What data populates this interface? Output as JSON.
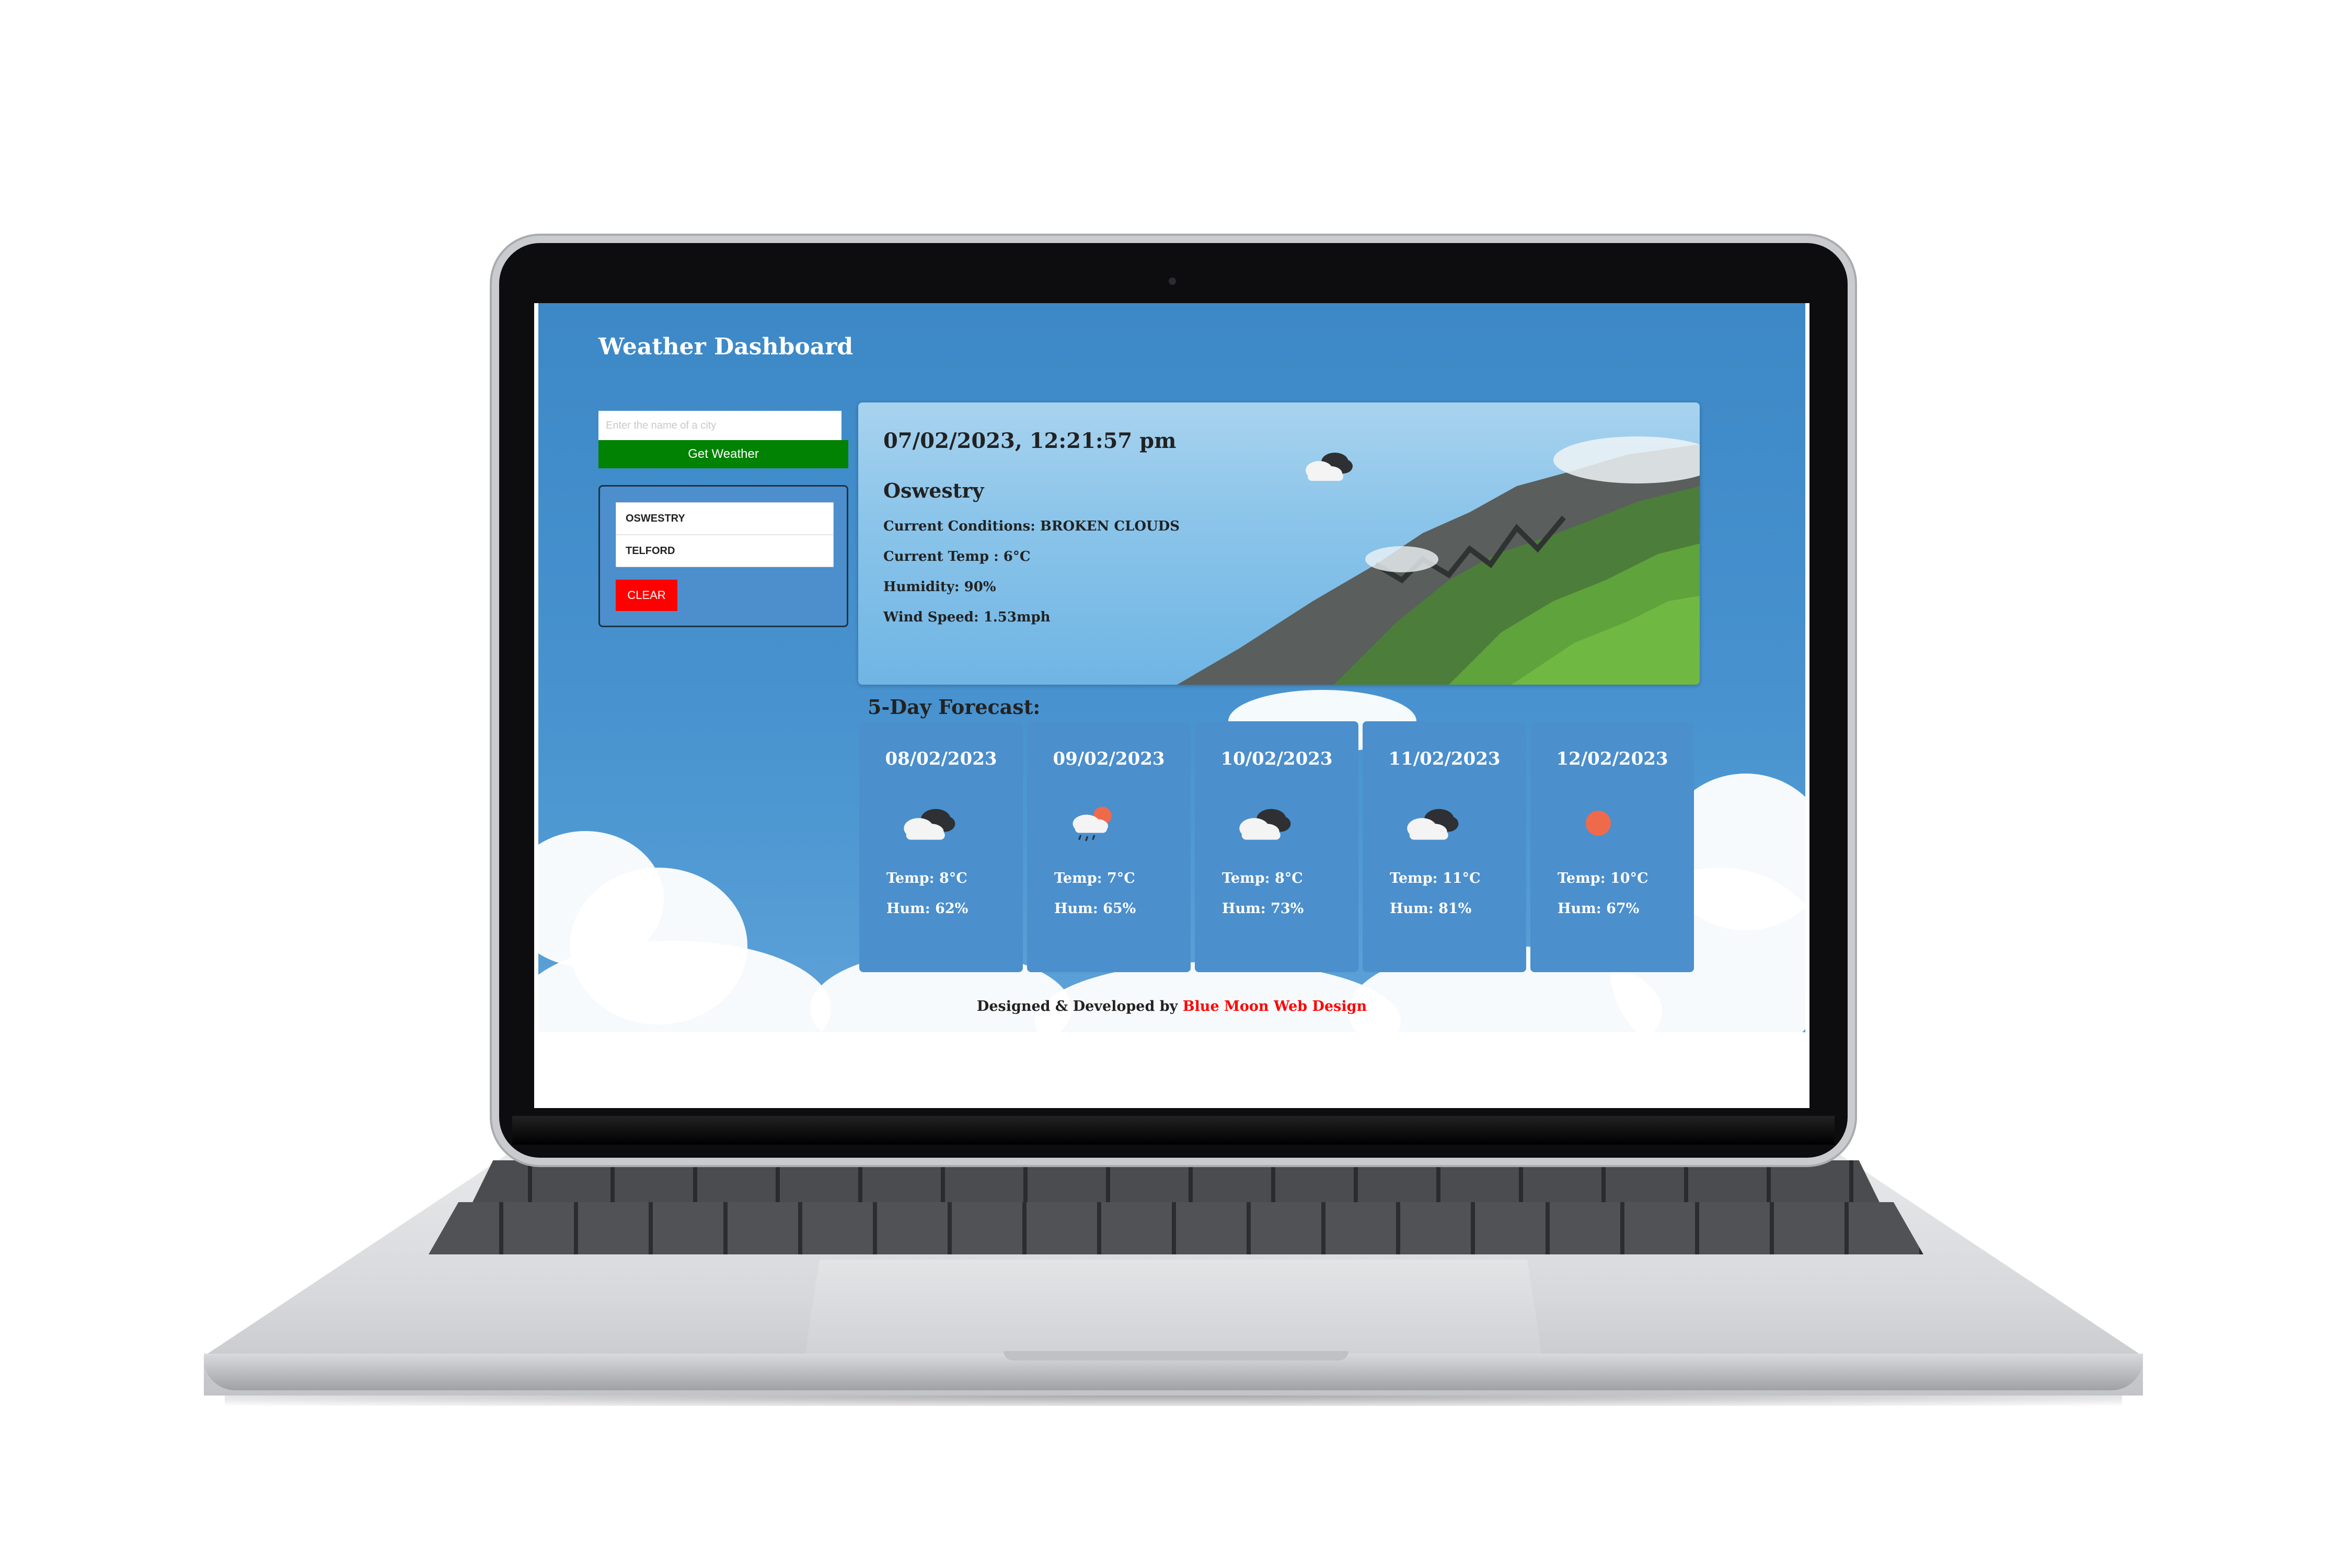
{
  "app": {
    "title": "Weather Dashboard"
  },
  "search": {
    "placeholder": "Enter the name of a city",
    "button_label": "Get Weather"
  },
  "history": {
    "items": [
      "OSWESTRY",
      "TELFORD"
    ],
    "clear_label": "CLEAR"
  },
  "current": {
    "datetime": "07/02/2023, 12:21:57 pm",
    "city": "Oswestry",
    "conditions": "Current Conditions: BROKEN CLOUDS",
    "temp": "Current Temp : 6°C",
    "humidity": "Humidity: 90%",
    "wind": "Wind Speed: 1.53mph",
    "icon": "broken-clouds-icon"
  },
  "forecast": {
    "title": "5-Day Forecast:",
    "days": [
      {
        "date": "08/02/2023",
        "icon": "broken-clouds-icon",
        "temp": "Temp: 8°C",
        "hum": "Hum: 62%"
      },
      {
        "date": "09/02/2023",
        "icon": "rain-sun-icon",
        "temp": "Temp: 7°C",
        "hum": "Hum: 65%"
      },
      {
        "date": "10/02/2023",
        "icon": "broken-clouds-icon",
        "temp": "Temp: 8°C",
        "hum": "Hum: 73%"
      },
      {
        "date": "11/02/2023",
        "icon": "broken-clouds-icon",
        "temp": "Temp: 11°C",
        "hum": "Hum: 81%"
      },
      {
        "date": "12/02/2023",
        "icon": "sun-icon",
        "temp": "Temp: 10°C",
        "hum": "Hum: 67%"
      }
    ]
  },
  "footer": {
    "text": "Designed & Developed by",
    "brand": "Blue Moon Web Design"
  },
  "colors": {
    "accent_green": "#028202",
    "clear_red": "#ff0000",
    "card_blue": "#4b8fcd",
    "brand_red": "#ff0000"
  }
}
